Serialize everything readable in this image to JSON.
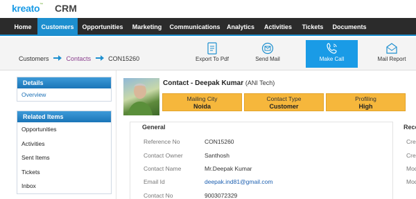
{
  "brand": {
    "logo": "kreato",
    "logo_mark": "™",
    "product": "CRM"
  },
  "nav": {
    "items": [
      {
        "label": "Home"
      },
      {
        "label": "Customers"
      },
      {
        "label": "Opportunities"
      },
      {
        "label": "Marketing"
      },
      {
        "label": "Communications"
      },
      {
        "label": "Analytics"
      },
      {
        "label": "Activities"
      },
      {
        "label": "Tickets"
      },
      {
        "label": "Documents"
      }
    ],
    "active": "Customers"
  },
  "breadcrumb": {
    "items": [
      "Customers",
      "Contacts",
      "CON15260"
    ]
  },
  "toolbar": {
    "export_pdf": "Export To Pdf",
    "send_mail": "Send Mail",
    "make_call": "Make Call",
    "mail_report": "Mail Report"
  },
  "sidebar": {
    "details": {
      "title": "Details",
      "items": [
        "Overview"
      ]
    },
    "related": {
      "title": "Related Items",
      "items": [
        "Opportunities",
        "Activities",
        "Sent Items",
        "Tickets",
        "Inbox"
      ]
    }
  },
  "contact": {
    "title_prefix": "Contact - Deepak Kumar",
    "company": "(ANI Tech)",
    "summary": [
      {
        "label": "Mailing City",
        "value": "Noida"
      },
      {
        "label": "Contact Type",
        "value": "Customer"
      },
      {
        "label": "Profiling",
        "value": "High"
      }
    ]
  },
  "general": {
    "title": "General",
    "fields": [
      {
        "label": "Reference No",
        "value": "CON15260"
      },
      {
        "label": "Contact Owner",
        "value": "Santhosh"
      },
      {
        "label": "Contact Name",
        "value": "Mr.Deepak Kumar"
      },
      {
        "label": "Email Id",
        "value": "deepak.ind81@gmail.com"
      },
      {
        "label": "Contact No",
        "value": "9003072329"
      }
    ]
  },
  "record": {
    "title": "Record",
    "labels": [
      "Created",
      "Created",
      "Modified",
      "Modified"
    ]
  },
  "colors": {
    "nav_bg": "#2b2b2b",
    "accent": "#1d8fcf",
    "summary": "#f6b73c",
    "breadcrumb_current": "#8a3f8e"
  }
}
